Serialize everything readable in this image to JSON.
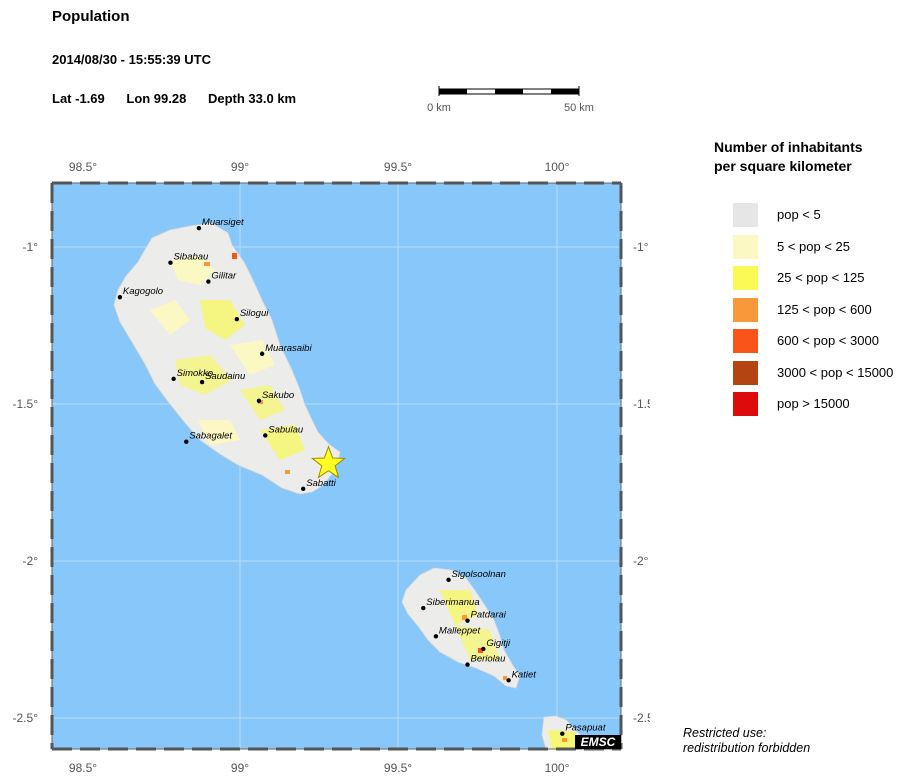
{
  "header": {
    "title": "Population",
    "datetime": "2014/08/30 - 15:55:39 UTC",
    "lat": "Lat -1.69",
    "lon": "Lon  99.28",
    "depth": "Depth  33.0 km"
  },
  "scale": {
    "start_label": "0 km",
    "end_label": "50 km"
  },
  "axes": {
    "lon_ticks": [
      "98.5°",
      "99°",
      "99.5°",
      "100°"
    ],
    "lat_ticks": [
      "-1°",
      "-1.5°",
      "-2°",
      "-2.5°"
    ]
  },
  "legend": {
    "title_line1": "Number of inhabitants",
    "title_line2": "per square kilometer",
    "items": [
      {
        "label": "pop < 5",
        "color": "#e6e6e6"
      },
      {
        "label": "5 < pop < 25",
        "color": "#fbf8c4"
      },
      {
        "label": "25 < pop < 125",
        "color": "#fafa55"
      },
      {
        "label": "125 < pop < 600",
        "color": "#f8983a"
      },
      {
        "label": "600 < pop < 3000",
        "color": "#f95419"
      },
      {
        "label": "3000 < pop < 15000",
        "color": "#b44512"
      },
      {
        "label": "pop > 15000",
        "color": "#dd0b0b"
      }
    ]
  },
  "towns": [
    {
      "name": "Muarsiget",
      "lon": 98.87,
      "lat": -0.94
    },
    {
      "name": "Sibabau",
      "lon": 98.78,
      "lat": -1.05
    },
    {
      "name": "Gilitar",
      "lon": 98.9,
      "lat": -1.11
    },
    {
      "name": "Kagogolo",
      "lon": 98.62,
      "lat": -1.16
    },
    {
      "name": "Silogui",
      "lon": 98.99,
      "lat": -1.23
    },
    {
      "name": "Muarasaibi",
      "lon": 99.07,
      "lat": -1.34
    },
    {
      "name": "Simokko",
      "lon": 98.79,
      "lat": -1.42
    },
    {
      "name": "Saudainu",
      "lon": 98.88,
      "lat": -1.43
    },
    {
      "name": "Sakubo",
      "lon": 99.06,
      "lat": -1.49
    },
    {
      "name": "Sabulau",
      "lon": 99.08,
      "lat": -1.6
    },
    {
      "name": "Sabagalet",
      "lon": 98.83,
      "lat": -1.62
    },
    {
      "name": "Sabatti",
      "lon": 99.2,
      "lat": -1.77
    },
    {
      "name": "Sigolsoolnan",
      "lon": 99.66,
      "lat": -2.06
    },
    {
      "name": "Siberimanua",
      "lon": 99.58,
      "lat": -2.15
    },
    {
      "name": "Patdarai",
      "lon": 99.72,
      "lat": -2.19
    },
    {
      "name": "Malleppet",
      "lon": 99.62,
      "lat": -2.24
    },
    {
      "name": "Gigitji",
      "lon": 99.77,
      "lat": -2.28
    },
    {
      "name": "Beriolau",
      "lon": 99.72,
      "lat": -2.33
    },
    {
      "name": "Katiet",
      "lon": 99.85,
      "lat": -2.38
    },
    {
      "name": "Pasapuat",
      "lon": 100.02,
      "lat": -2.55
    }
  ],
  "epicenter": {
    "lon": 99.28,
    "lat": -1.69,
    "color": "#ffff22"
  },
  "colors": {
    "ocean": "#87c7f9",
    "land": "#ececea"
  },
  "logo": "EMSC",
  "restricted_line1": "Restricted use:",
  "restricted_line2": "redistribution forbidden"
}
